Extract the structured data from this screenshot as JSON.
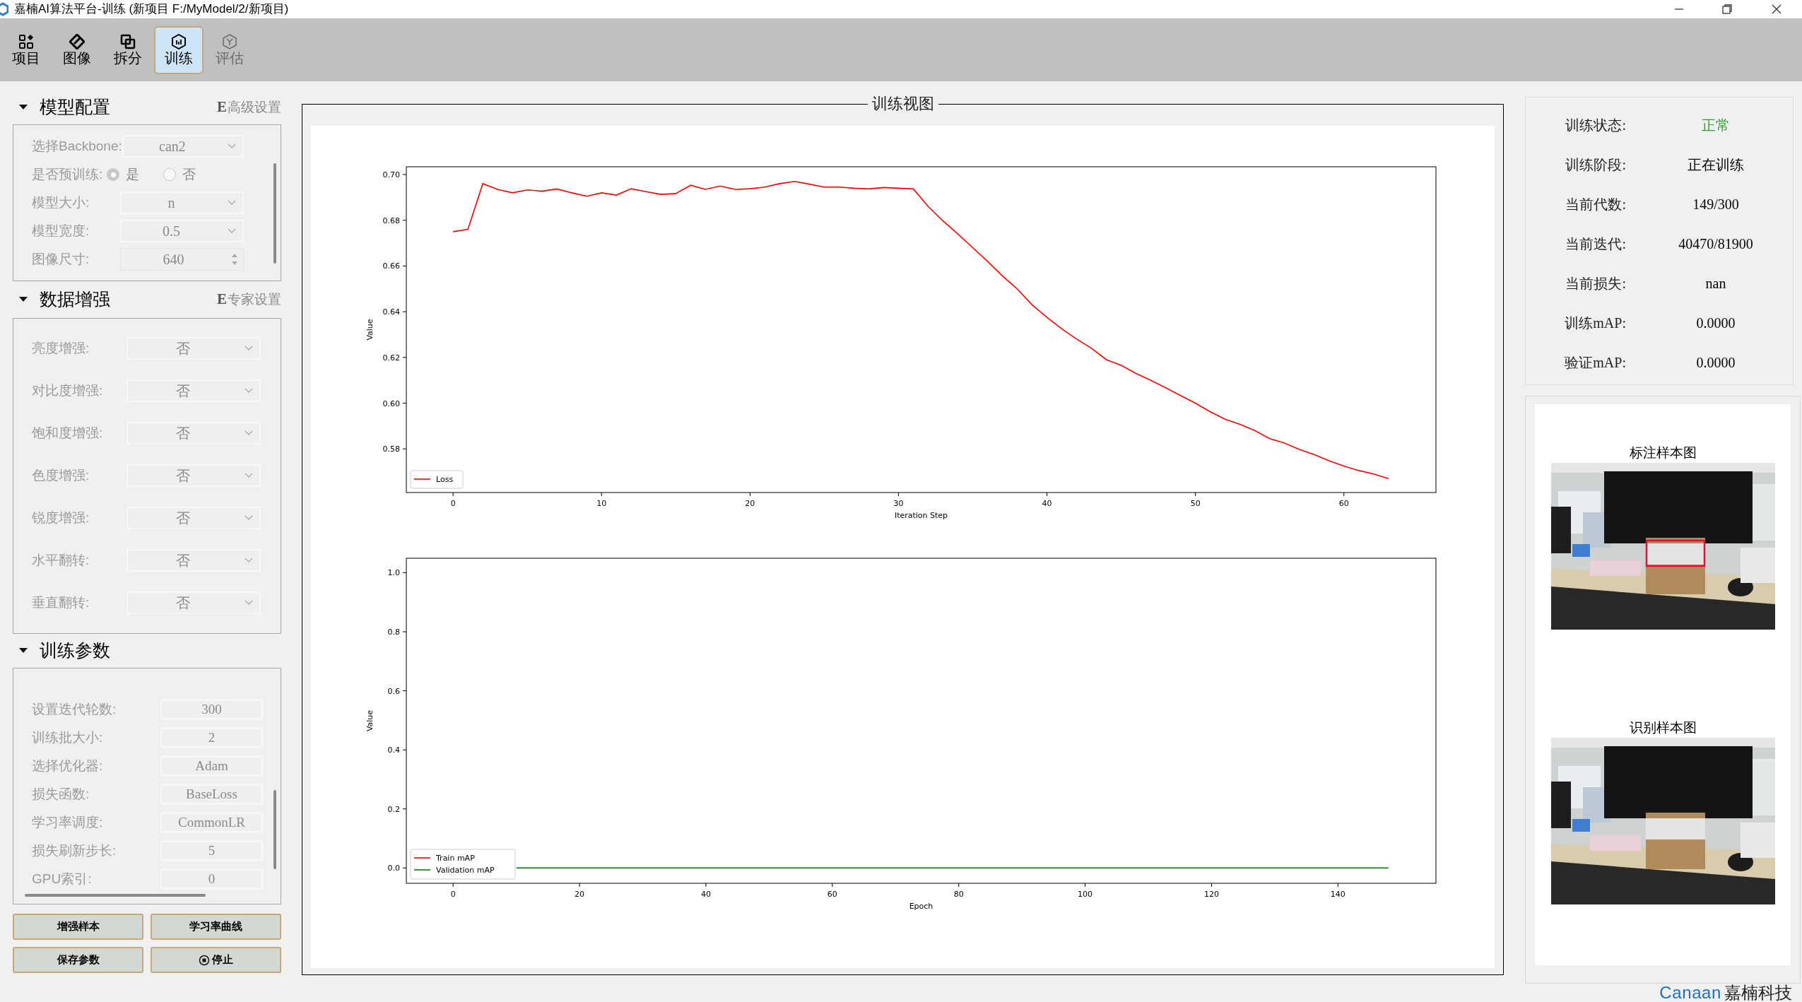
{
  "window": {
    "title": "嘉楠AI算法平台-训练 (新项目  F:/MyModel/2/新项目)"
  },
  "toolbar": [
    {
      "label": "项目",
      "selected": false,
      "disabled": false
    },
    {
      "label": "图像",
      "selected": false,
      "disabled": false
    },
    {
      "label": "拆分",
      "selected": false,
      "disabled": false
    },
    {
      "label": "训练",
      "selected": true,
      "disabled": false
    },
    {
      "label": "评估",
      "selected": false,
      "disabled": true
    }
  ],
  "sections": [
    {
      "title": "模型配置",
      "expanded": true,
      "link_mark": "E",
      "link": "高级设置",
      "fields": [
        {
          "label": "选择Backbone:",
          "kind": "combo",
          "value": "can2",
          "disabled": true
        },
        {
          "label": "是否预训练:",
          "kind": "radio",
          "disabled": true,
          "options": [
            {
              "label": "是",
              "selected": true
            },
            {
              "label": "否",
              "selected": false
            }
          ]
        },
        {
          "label": "模型大小:",
          "kind": "combo",
          "value": "n",
          "disabled": true
        },
        {
          "label": "模型宽度:",
          "kind": "combo",
          "value": "0.5",
          "disabled": true
        },
        {
          "label": "图像尺寸:",
          "kind": "spin",
          "value": "640",
          "disabled": true
        }
      ]
    },
    {
      "title": "数据增强",
      "expanded": true,
      "link_mark": "E",
      "link": "专家设置",
      "fields": [
        {
          "label": "亮度增强:",
          "kind": "combo",
          "value": "否",
          "disabled": true
        },
        {
          "label": "对比度增强:",
          "kind": "combo",
          "value": "否",
          "disabled": true
        },
        {
          "label": "饱和度增强:",
          "kind": "combo",
          "value": "否",
          "disabled": true
        },
        {
          "label": "色度增强:",
          "kind": "combo",
          "value": "否",
          "disabled": true
        },
        {
          "label": "锐度增强:",
          "kind": "combo",
          "value": "否",
          "disabled": true
        },
        {
          "label": "水平翻转:",
          "kind": "combo",
          "value": "否",
          "disabled": true
        },
        {
          "label": "垂直翻转:",
          "kind": "combo",
          "value": "否",
          "disabled": true
        }
      ]
    },
    {
      "title": "训练参数",
      "expanded": true,
      "fields": [
        {
          "label": "设置迭代轮数:",
          "kind": "text",
          "value": "300",
          "disabled": true
        },
        {
          "label": "训练批大小:",
          "kind": "text",
          "value": "2",
          "disabled": true
        },
        {
          "label": "选择优化器:",
          "kind": "text",
          "value": "Adam",
          "disabled": true
        },
        {
          "label": "损失函数:",
          "kind": "text",
          "value": "BaseLoss",
          "disabled": true
        },
        {
          "label": "学习率调度:",
          "kind": "text",
          "value": "CommonLR",
          "disabled": true
        },
        {
          "label": "损失刷新步长:",
          "kind": "text",
          "value": "5",
          "disabled": true
        },
        {
          "label": "GPU索引:",
          "kind": "text",
          "value": "0",
          "disabled": true
        }
      ]
    }
  ],
  "buttons": [
    {
      "label": "增强样本",
      "kind": "plain"
    },
    {
      "label": "学习率曲线",
      "kind": "plain"
    },
    {
      "label": "保存参数",
      "kind": "plain"
    },
    {
      "label": "停止",
      "kind": "stop"
    }
  ],
  "view": {
    "title": "训练视图",
    "charts": [
      {
        "chart_data": {
          "type": "line",
          "xlabel": "Iteration Step",
          "ylabel": "Value",
          "legend": "lower left",
          "x": [
            0,
            1,
            2,
            3,
            4,
            5,
            6,
            7,
            8,
            9,
            10,
            11,
            12,
            13,
            14,
            15,
            16,
            17,
            18,
            19,
            20,
            21,
            22,
            23,
            24,
            25,
            26,
            27,
            28,
            29,
            30,
            31,
            32,
            33,
            34,
            35,
            36,
            37,
            38,
            39,
            40,
            41,
            42,
            43,
            44,
            45,
            46,
            47,
            48,
            49,
            50,
            51,
            52,
            53,
            54,
            55,
            56,
            57,
            58,
            59,
            60,
            61,
            62,
            63
          ],
          "series": [
            {
              "name": "Loss",
              "color": "#ff0000",
              "values": [
                0.675,
                0.676,
                0.696,
                0.6935,
                0.692,
                0.6933,
                0.6927,
                0.6937,
                0.692,
                0.6905,
                0.692,
                0.691,
                0.6938,
                0.6925,
                0.6913,
                0.6917,
                0.6953,
                0.6935,
                0.695,
                0.6935,
                0.6938,
                0.6945,
                0.696,
                0.697,
                0.6958,
                0.6945,
                0.6945,
                0.694,
                0.6937,
                0.6943,
                0.694,
                0.6937,
                0.686,
                0.6797,
                0.674,
                0.668,
                0.662,
                0.6557,
                0.65,
                0.643,
                0.6375,
                0.6325,
                0.628,
                0.624,
                0.619,
                0.6165,
                0.613,
                0.61,
                0.6067,
                0.6033,
                0.6,
                0.5962,
                0.593,
                0.5907,
                0.588,
                0.5845,
                0.5825,
                0.5798,
                0.5775,
                0.5748,
                0.5725,
                0.5705,
                0.569,
                0.567
              ]
            }
          ],
          "xlim": [
            -3.15,
            66.2
          ],
          "ylim": [
            0.5609,
            0.7034
          ],
          "xticks": [
            0,
            10,
            20,
            30,
            40,
            50,
            60
          ],
          "yticks": [
            {
              "value": 0.58,
              "label": "0.58"
            },
            {
              "value": 0.6,
              "label": "0.60"
            },
            {
              "value": 0.62,
              "label": "0.62"
            },
            {
              "value": 0.64,
              "label": "0.64"
            },
            {
              "value": 0.66,
              "label": "0.66"
            },
            {
              "value": 0.68,
              "label": "0.68"
            },
            {
              "value": 0.7,
              "label": "0.70"
            }
          ]
        }
      },
      {
        "chart_data": {
          "type": "line",
          "xlabel": "Epoch",
          "ylabel": "Value",
          "legend": "lower left",
          "x": [
            10,
            11,
            12,
            13,
            14,
            15,
            16,
            17,
            18,
            19,
            20,
            21,
            22,
            23,
            24,
            25,
            26,
            27,
            28,
            29,
            30,
            31,
            32,
            33,
            34,
            35,
            36,
            37,
            38,
            39,
            40,
            41,
            42,
            43,
            44,
            45,
            46,
            47,
            48,
            49,
            50,
            51,
            52,
            53,
            54,
            55,
            56,
            57,
            58,
            59,
            60,
            61,
            62,
            63,
            64,
            65,
            66,
            67,
            68,
            69,
            70,
            71,
            72,
            73,
            74,
            75,
            76,
            77,
            78,
            79,
            80,
            81,
            82,
            83,
            84,
            85,
            86,
            87,
            88,
            89,
            90,
            91,
            92,
            93,
            94,
            95,
            96,
            97,
            98,
            99,
            100,
            101,
            102,
            103,
            104,
            105,
            106,
            107,
            108,
            109,
            110,
            111,
            112,
            113,
            114,
            115,
            116,
            117,
            118,
            119,
            120,
            121,
            122,
            123,
            124,
            125,
            126,
            127,
            128,
            129,
            130,
            131,
            132,
            133,
            134,
            135,
            136,
            137,
            138,
            139,
            140,
            141,
            142,
            143,
            144,
            145,
            146,
            147,
            148
          ],
          "series": [
            {
              "name": "Train mAP",
              "color": "#ff0000",
              "values": [
                null,
                null,
                null,
                null,
                null,
                null,
                null,
                null,
                null,
                null,
                null,
                null,
                null,
                null,
                null,
                null,
                null,
                null,
                null,
                null,
                null,
                null,
                null,
                null,
                null,
                null,
                null,
                null,
                null,
                null,
                null,
                null,
                null,
                null,
                null,
                null,
                null,
                null,
                null,
                null,
                null,
                null,
                null,
                null,
                null,
                null,
                null,
                null,
                null,
                null,
                null,
                null,
                null,
                null,
                null,
                null,
                null,
                null,
                null,
                null,
                null,
                null,
                null,
                null,
                null,
                null,
                null,
                null,
                null,
                null,
                null,
                null,
                null,
                null,
                null,
                null,
                null,
                null,
                null,
                null,
                null,
                null,
                null,
                null,
                null,
                null,
                null,
                null,
                null,
                null,
                null,
                null,
                null,
                null,
                null,
                null,
                null,
                null,
                null,
                null,
                null,
                null,
                null,
                null,
                null,
                null,
                null,
                null,
                null,
                null,
                null,
                null,
                null,
                null,
                null,
                null,
                null,
                null,
                null,
                null,
                null,
                null,
                null,
                null,
                null,
                null,
                null,
                null,
                null,
                null,
                null,
                null,
                null,
                null,
                null,
                null,
                null,
                null,
                null
              ]
            },
            {
              "name": "Validation mAP",
              "color": "#008000",
              "values": [
                0,
                0,
                0,
                0,
                0,
                0,
                0,
                0,
                0,
                0,
                0,
                0,
                0,
                0,
                0,
                0,
                0,
                0,
                0,
                0,
                0,
                0,
                0,
                0,
                0,
                0,
                0,
                0,
                0,
                0,
                0,
                0,
                0,
                0,
                0,
                0,
                0,
                0,
                0,
                0,
                0,
                0,
                0,
                0,
                0,
                0,
                0,
                0,
                0,
                0,
                0,
                0,
                0,
                0,
                0,
                0,
                0,
                0,
                0,
                0,
                0,
                0,
                0,
                0,
                0,
                0,
                0,
                0,
                0,
                0,
                0,
                0,
                0,
                0,
                0,
                0,
                0,
                0,
                0,
                0,
                0,
                0,
                0,
                0,
                0,
                0,
                0,
                0,
                0,
                0,
                0,
                0,
                0,
                0,
                0,
                0,
                0,
                0,
                0,
                0,
                0,
                0,
                0,
                0,
                0,
                0,
                0,
                0,
                0,
                0,
                0,
                0,
                0,
                0,
                0,
                0,
                0,
                0,
                0,
                0,
                0,
                0,
                0,
                0,
                0,
                0,
                0,
                0,
                0,
                0,
                0,
                0,
                0,
                0,
                0,
                0,
                0,
                0,
                0
              ]
            }
          ],
          "xlim": [
            -7.4,
            155.5
          ],
          "ylim": [
            -0.052,
            1.049
          ],
          "xticks": [
            0,
            20,
            40,
            60,
            80,
            100,
            120,
            140
          ],
          "yticks": [
            {
              "value": 0,
              "label": "0.0"
            },
            {
              "value": 0.2,
              "label": "0.2"
            },
            {
              "value": 0.4,
              "label": "0.4"
            },
            {
              "value": 0.6,
              "label": "0.6"
            },
            {
              "value": 0.8,
              "label": "0.8"
            },
            {
              "value": 1,
              "label": "1.0"
            }
          ]
        }
      }
    ]
  },
  "status": [
    {
      "label": "训练状态:",
      "value": "正常",
      "color": "#3a9a3a"
    },
    {
      "label": "训练阶段:",
      "value": "正在训练",
      "color": "#000000"
    },
    {
      "label": "当前代数:",
      "value": "149/300",
      "color": "#000000"
    },
    {
      "label": "当前迭代:",
      "value": "40470/81900",
      "color": "#000000"
    },
    {
      "label": "当前损失:",
      "value": "nan",
      "color": "#000000"
    },
    {
      "label": "训练mAP:",
      "value": "0.0000",
      "color": "#000000"
    },
    {
      "label": "验证mAP:",
      "value": "0.0000",
      "color": "#000000"
    }
  ],
  "samples": [
    {
      "title": "标注样本图"
    },
    {
      "title": "识别样本图"
    }
  ],
  "brand": {
    "logo": "Canaan",
    "name": "嘉楠科技"
  }
}
